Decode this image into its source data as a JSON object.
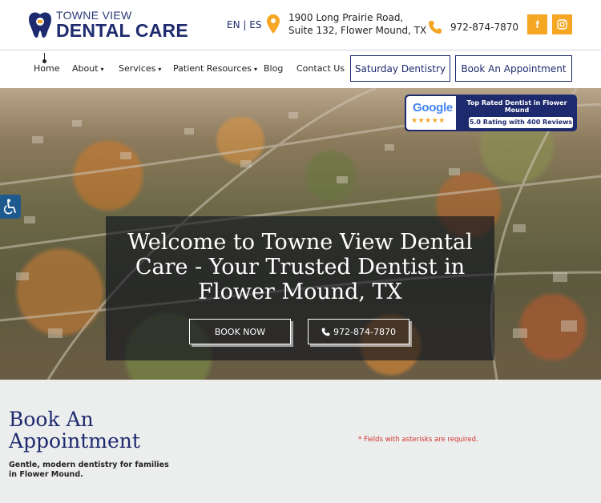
{
  "brand": {
    "line1": "TOWNE VIEW",
    "line2": "DENTAL CARE",
    "primary_color": "#1e2a6e",
    "accent_color": "#f5a623"
  },
  "header": {
    "lang_en": "EN",
    "lang_sep": "|",
    "lang_es": "ES",
    "address_line1": "1900 Long Prairie Road,",
    "address_line2": "Suite 132, Flower Mound, TX",
    "phone": "972-874-7870",
    "social_facebook": "f",
    "social_instagram": "instagram-icon"
  },
  "nav": {
    "items": [
      {
        "label": "Home"
      },
      {
        "label": "About"
      },
      {
        "label": "Services"
      },
      {
        "label": "Patient Resources"
      },
      {
        "label": "Blog"
      },
      {
        "label": "Contact Us"
      }
    ],
    "saturday_button": "Saturday Dentistry",
    "book_button": "Book An Appointment"
  },
  "review": {
    "brand": "Google",
    "stars": "★★★★★",
    "title": "Top Rated Dentist in Flower Mound",
    "rating": "5.0 Rating with 400 Reviews"
  },
  "hero": {
    "title": "Welcome to Towne View Dental Care - Your Trusted Dentist in Flower Mound, TX",
    "book_button": "BOOK NOW",
    "call_button": "972-874-7870"
  },
  "book_section": {
    "title": "Book An Appointment",
    "subtitle": "Gentle, modern dentistry for families in Flower Mound.",
    "required_note": "* Fields with asterisks are required."
  }
}
